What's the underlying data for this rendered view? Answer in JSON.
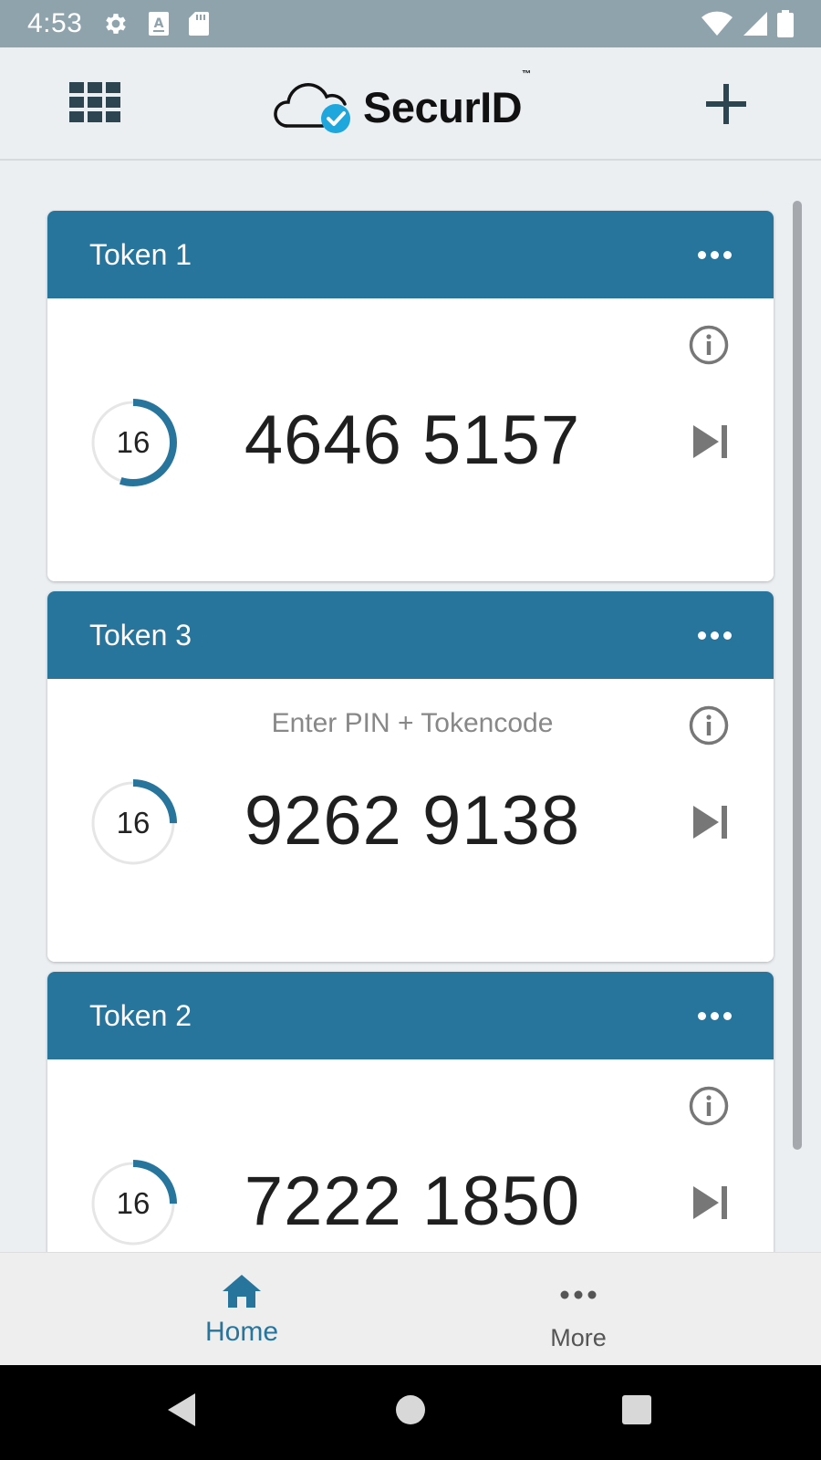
{
  "status_bar": {
    "time": "4:53",
    "icons_left": [
      "gear-icon",
      "font-icon",
      "sd-card-icon"
    ],
    "icons_right": [
      "wifi-icon",
      "signal-icon",
      "battery-icon"
    ]
  },
  "header": {
    "logo_text": "SecurID",
    "logo_tm": "™",
    "menu_icon": "grid-icon",
    "add_icon": "plus-icon"
  },
  "tokens": [
    {
      "title": "Token 1",
      "hint": "",
      "code": "4646 5157",
      "seconds": "16",
      "progress": 0.55
    },
    {
      "title": "Token 3",
      "hint": "Enter PIN + Tokencode",
      "code": "9262 9138",
      "seconds": "16",
      "progress": 0.25
    },
    {
      "title": "Token 2",
      "hint": "",
      "code": "7222 1850",
      "seconds": "16",
      "progress": 0.25
    }
  ],
  "bottom_nav": {
    "home_label": "Home",
    "more_label": "More"
  },
  "colors": {
    "accent": "#27759c",
    "status_bar": "#8fa3ad",
    "background": "#eceff2",
    "ring_track": "#e6e6e6"
  }
}
